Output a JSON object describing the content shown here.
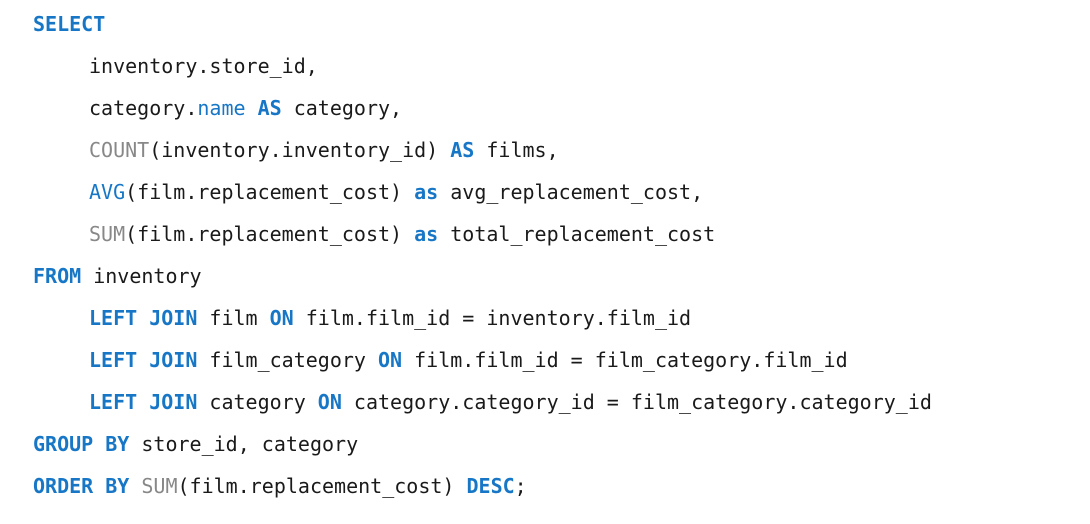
{
  "editor": {
    "language": "SQL",
    "colors": {
      "keyword": "#1777c6",
      "function": "#888888",
      "text": "#1a1a1a",
      "background": "#ffffff"
    },
    "lines": [
      {
        "tokens": [
          {
            "t": "SELECT",
            "k": "kw"
          }
        ],
        "indent": 0
      },
      {
        "tokens": [
          {
            "t": "inventory.store_id,",
            "k": "plain"
          }
        ],
        "indent": 1
      },
      {
        "tokens": [
          {
            "t": "category.",
            "k": "plain"
          },
          {
            "t": "name",
            "k": "fn-blue"
          },
          {
            "t": " ",
            "k": "plain"
          },
          {
            "t": "AS",
            "k": "kw"
          },
          {
            "t": " category,",
            "k": "plain"
          }
        ],
        "indent": 1
      },
      {
        "tokens": [
          {
            "t": "COUNT",
            "k": "fn"
          },
          {
            "t": "(inventory.inventory_id) ",
            "k": "plain"
          },
          {
            "t": "AS",
            "k": "kw"
          },
          {
            "t": " films,",
            "k": "plain"
          }
        ],
        "indent": 1
      },
      {
        "tokens": [
          {
            "t": "AVG",
            "k": "fn-blue"
          },
          {
            "t": "(film.replacement_cost) ",
            "k": "plain"
          },
          {
            "t": "as",
            "k": "kw"
          },
          {
            "t": " avg_replacement_cost,",
            "k": "plain"
          }
        ],
        "indent": 1
      },
      {
        "tokens": [
          {
            "t": "SUM",
            "k": "fn"
          },
          {
            "t": "(film.replacement_cost) ",
            "k": "plain"
          },
          {
            "t": "as",
            "k": "kw"
          },
          {
            "t": " total_replacement_cost",
            "k": "plain"
          }
        ],
        "indent": 1
      },
      {
        "tokens": [
          {
            "t": "FROM",
            "k": "kw"
          },
          {
            "t": " inventory",
            "k": "plain"
          }
        ],
        "indent": 0
      },
      {
        "tokens": [
          {
            "t": "LEFT JOIN",
            "k": "kw"
          },
          {
            "t": " film ",
            "k": "plain"
          },
          {
            "t": "ON",
            "k": "kw"
          },
          {
            "t": " film.film_id = inventory.film_id",
            "k": "plain"
          }
        ],
        "indent": 1
      },
      {
        "tokens": [
          {
            "t": "LEFT JOIN",
            "k": "kw"
          },
          {
            "t": " film_category ",
            "k": "plain"
          },
          {
            "t": "ON",
            "k": "kw"
          },
          {
            "t": " film.film_id = film_category.film_id",
            "k": "plain"
          }
        ],
        "indent": 1
      },
      {
        "tokens": [
          {
            "t": "LEFT JOIN",
            "k": "kw"
          },
          {
            "t": " category ",
            "k": "plain"
          },
          {
            "t": "ON",
            "k": "kw"
          },
          {
            "t": " category.category_id = film_category.category_id",
            "k": "plain"
          }
        ],
        "indent": 1
      },
      {
        "tokens": [
          {
            "t": "GROUP BY",
            "k": "kw"
          },
          {
            "t": " store_id, category",
            "k": "plain"
          }
        ],
        "indent": 0
      },
      {
        "tokens": [
          {
            "t": "ORDER BY",
            "k": "kw"
          },
          {
            "t": " ",
            "k": "plain"
          },
          {
            "t": "SUM",
            "k": "fn"
          },
          {
            "t": "(film.replacement_cost) ",
            "k": "plain"
          },
          {
            "t": "DESC",
            "k": "kw"
          },
          {
            "t": ";",
            "k": "plain"
          }
        ],
        "indent": 0
      }
    ]
  }
}
